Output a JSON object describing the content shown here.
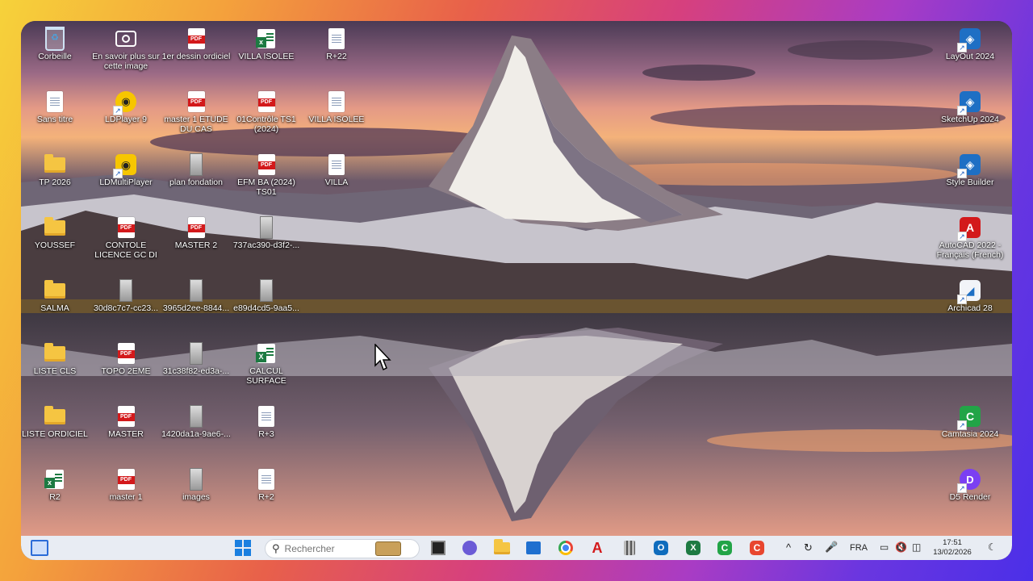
{
  "desktop_icons": [
    {
      "label": "Corbeille",
      "icon": "recycle-bin-icon"
    },
    {
      "label": "En savoir plus sur cette image",
      "icon": "camera-icon"
    },
    {
      "label": "1er dessin ordiciel",
      "icon": "pdf-icon"
    },
    {
      "label": "VILLA ISOLEE",
      "icon": "spreadsheet-icon"
    },
    {
      "label": "R+22",
      "icon": "document-icon"
    },
    {
      "label": "Sans titre",
      "icon": "document-icon"
    },
    {
      "label": "LDPlayer 9",
      "icon": "ldplayer-icon"
    },
    {
      "label": "master 1 ETUDE DU CAS",
      "icon": "pdf-icon"
    },
    {
      "label": "01Contrôle TS1 (2024)",
      "icon": "pdf-icon"
    },
    {
      "label": "VILLA ISOLEE",
      "icon": "document-icon"
    },
    {
      "label": "TP 2026",
      "icon": "folder-icon"
    },
    {
      "label": "LDMultiPlayer",
      "icon": "ldmultiplayer-icon"
    },
    {
      "label": "plan fondation",
      "icon": "image-file-icon"
    },
    {
      "label": "EFM BA (2024) TS01",
      "icon": "pdf-icon"
    },
    {
      "label": "VILLA",
      "icon": "document-icon"
    },
    {
      "label": "YOUSSEF",
      "icon": "folder-icon"
    },
    {
      "label": "CONTOLE LICENCE GC DI",
      "icon": "pdf-icon"
    },
    {
      "label": "MASTER 2",
      "icon": "pdf-icon"
    },
    {
      "label": "737ac390-d3f2-...",
      "icon": "image-file-icon"
    },
    {
      "label": "SALMA",
      "icon": "folder-icon"
    },
    {
      "label": "30d8c7c7-cc23...",
      "icon": "image-file-icon"
    },
    {
      "label": "3965d2ee-8844...",
      "icon": "image-file-icon"
    },
    {
      "label": "e89d4cd5-9aa5...",
      "icon": "image-file-icon"
    },
    {
      "label": "LISTE CLS",
      "icon": "folder-icon"
    },
    {
      "label": "TOPO 2EME",
      "icon": "pdf-icon"
    },
    {
      "label": "31c38f82-ed3a-...",
      "icon": "image-file-icon"
    },
    {
      "label": "CALCUL SURFACE",
      "icon": "excel-icon"
    },
    {
      "label": "LISTE ORDICIEL",
      "icon": "folder-icon"
    },
    {
      "label": "MASTER",
      "icon": "pdf-icon"
    },
    {
      "label": "1420da1a-9ae6-...",
      "icon": "image-file-icon"
    },
    {
      "label": "R+3",
      "icon": "document-icon"
    },
    {
      "label": "R2",
      "icon": "spreadsheet-icon"
    },
    {
      "label": "master 1",
      "icon": "pdf-icon"
    },
    {
      "label": "images",
      "icon": "image-file-icon"
    },
    {
      "label": "R+2",
      "icon": "document-icon"
    },
    {
      "label": "LayOut 2024",
      "icon": "layout-icon"
    },
    {
      "label": "SketchUp 2024",
      "icon": "sketchup-icon"
    },
    {
      "label": "Style Builder",
      "icon": "style-builder-icon"
    },
    {
      "label": "AutoCAD 2022 - Français (French)",
      "icon": "autocad-icon"
    },
    {
      "label": "Archicad 28",
      "icon": "archicad-icon"
    },
    {
      "label": "Camtasia 2024",
      "icon": "camtasia-icon"
    },
    {
      "label": "D5 Render",
      "icon": "d5-render-icon"
    }
  ],
  "taskbar": {
    "search_placeholder": "Rechercher",
    "apps": [
      "start-icon",
      "widgets-icon",
      "task-view-icon",
      "teams-icon",
      "file-explorer-icon",
      "store-icon",
      "chrome-icon",
      "autocad-icon",
      "calculator-icon",
      "outlook-icon",
      "excel-icon",
      "camtasia-icon",
      "camtasia-rec-icon"
    ],
    "language": "FRA",
    "time": "17:51",
    "date": "13/02/2026"
  },
  "colors": {
    "pdf": "#d3191b",
    "folder": "#f5c542",
    "taskbar": "#e8ecf3",
    "sketchup": "#1e6fc4",
    "autocad": "#d3191b",
    "camtasia": "#22a447"
  }
}
